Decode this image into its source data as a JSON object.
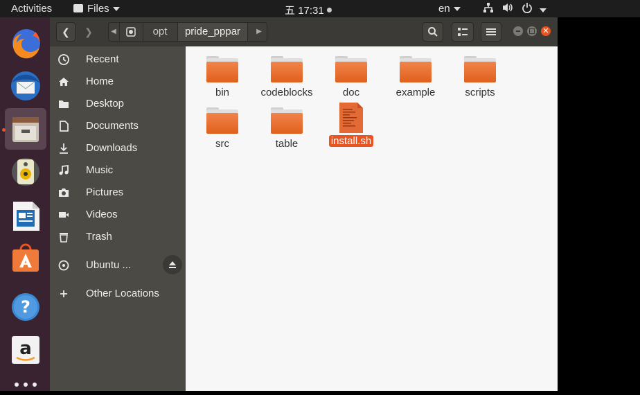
{
  "topbar": {
    "activities": "Activities",
    "app_menu": "Files",
    "clock_prefix": "五",
    "clock": "17:31",
    "language": "en"
  },
  "dock": {
    "items": [
      {
        "name": "firefox"
      },
      {
        "name": "thunderbird"
      },
      {
        "name": "files",
        "active": true
      },
      {
        "name": "rhythmbox"
      },
      {
        "name": "libreoffice-writer"
      },
      {
        "name": "ubuntu-software"
      },
      {
        "name": "help"
      },
      {
        "name": "amazon"
      },
      {
        "name": "show-applications"
      }
    ]
  },
  "header": {
    "path": [
      "opt",
      "pride_pppar"
    ]
  },
  "sidebar": {
    "items": [
      {
        "label": "Recent",
        "icon": "clock-icon"
      },
      {
        "label": "Home",
        "icon": "home-icon"
      },
      {
        "label": "Desktop",
        "icon": "folder-icon"
      },
      {
        "label": "Documents",
        "icon": "document-icon"
      },
      {
        "label": "Downloads",
        "icon": "download-icon"
      },
      {
        "label": "Music",
        "icon": "music-icon"
      },
      {
        "label": "Pictures",
        "icon": "camera-icon"
      },
      {
        "label": "Videos",
        "icon": "video-icon"
      },
      {
        "label": "Trash",
        "icon": "trash-icon"
      },
      {
        "label": "Ubuntu ...",
        "icon": "disc-icon"
      },
      {
        "label": "Other Locations",
        "icon": "plus-icon"
      }
    ]
  },
  "files": [
    {
      "name": "bin",
      "type": "folder"
    },
    {
      "name": "codeblocks",
      "type": "folder"
    },
    {
      "name": "doc",
      "type": "folder"
    },
    {
      "name": "example",
      "type": "folder"
    },
    {
      "name": "scripts",
      "type": "folder"
    },
    {
      "name": "src",
      "type": "folder"
    },
    {
      "name": "table",
      "type": "folder"
    },
    {
      "name": "install.sh",
      "type": "script",
      "selected": true
    }
  ],
  "colors": {
    "accent": "#e95420",
    "dock_bg": "#3a2330",
    "header_bg": "#3b3a37",
    "sidebar_bg": "#4b4a45"
  }
}
